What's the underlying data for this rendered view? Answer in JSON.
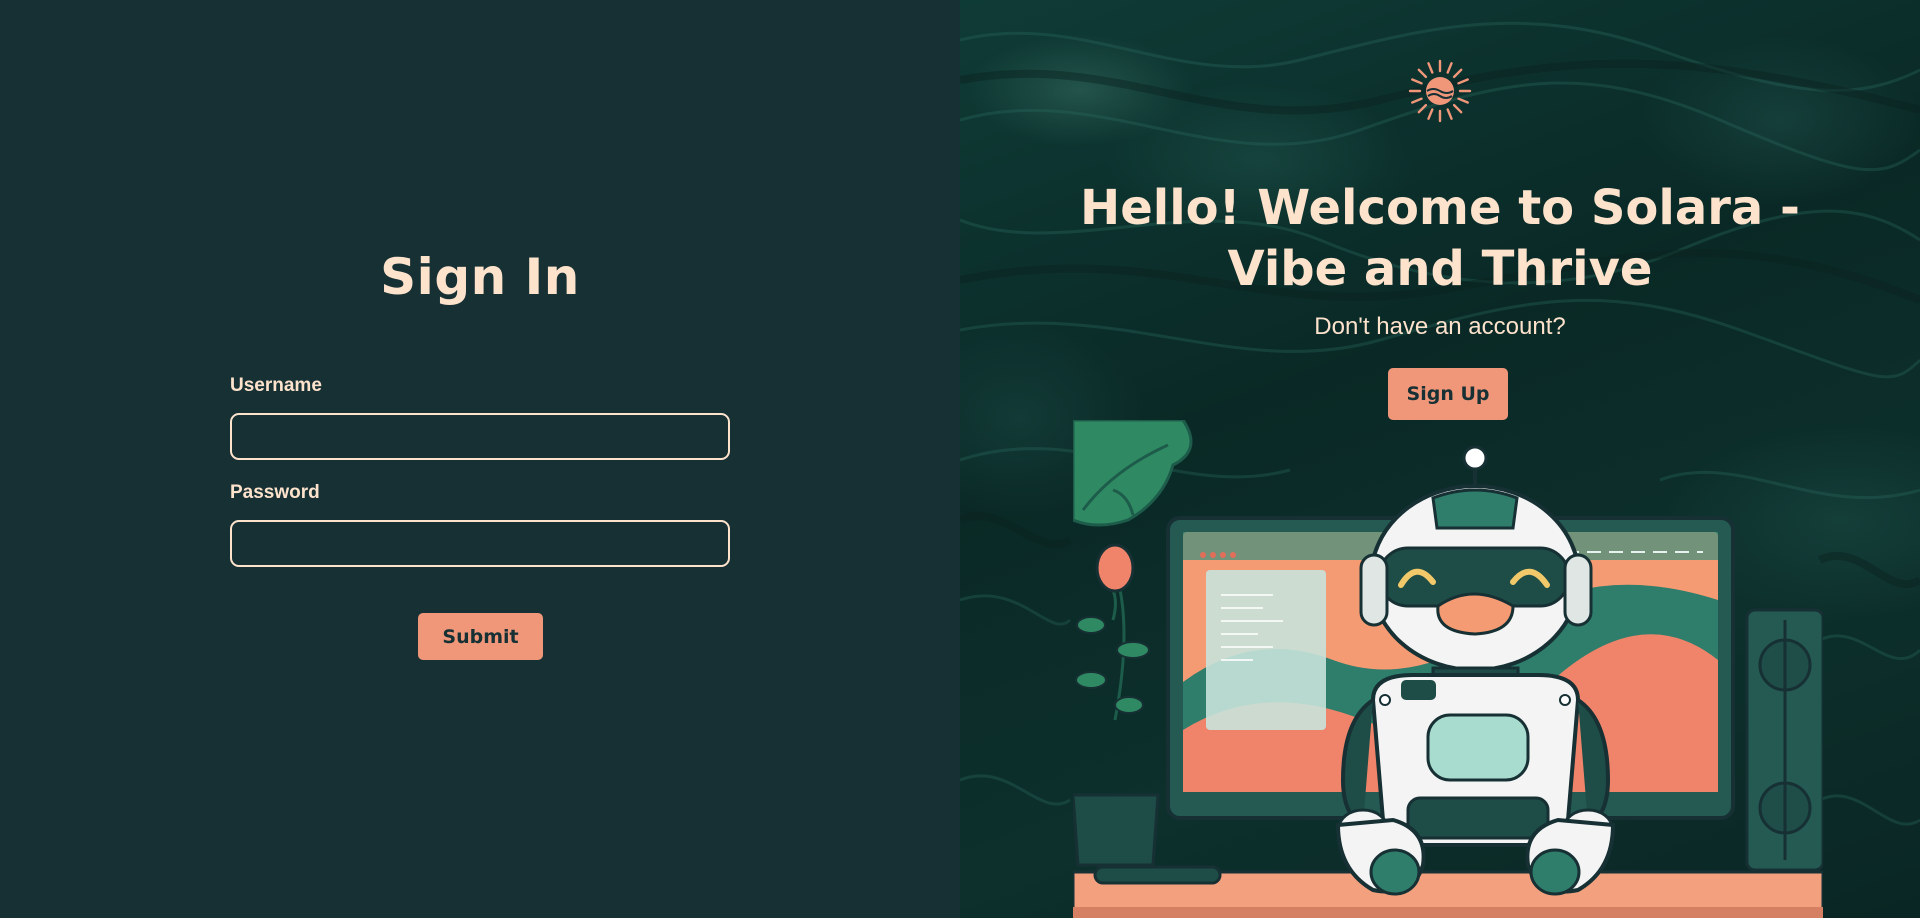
{
  "signin": {
    "title": "Sign In",
    "username_label": "Username",
    "username_value": "",
    "password_label": "Password",
    "password_value": "",
    "submit_label": "Submit"
  },
  "welcome": {
    "logo_icon": "sun-logo-icon",
    "title": "Hello! Welcome to Solara - Vibe and Thrive",
    "no_account_text": "Don't have an account?",
    "signup_label": "Sign Up",
    "illustration": "robot-at-desk-illustration"
  },
  "colors": {
    "background": "#163034",
    "text": "#fde2cc",
    "accent": "#f0977a"
  }
}
